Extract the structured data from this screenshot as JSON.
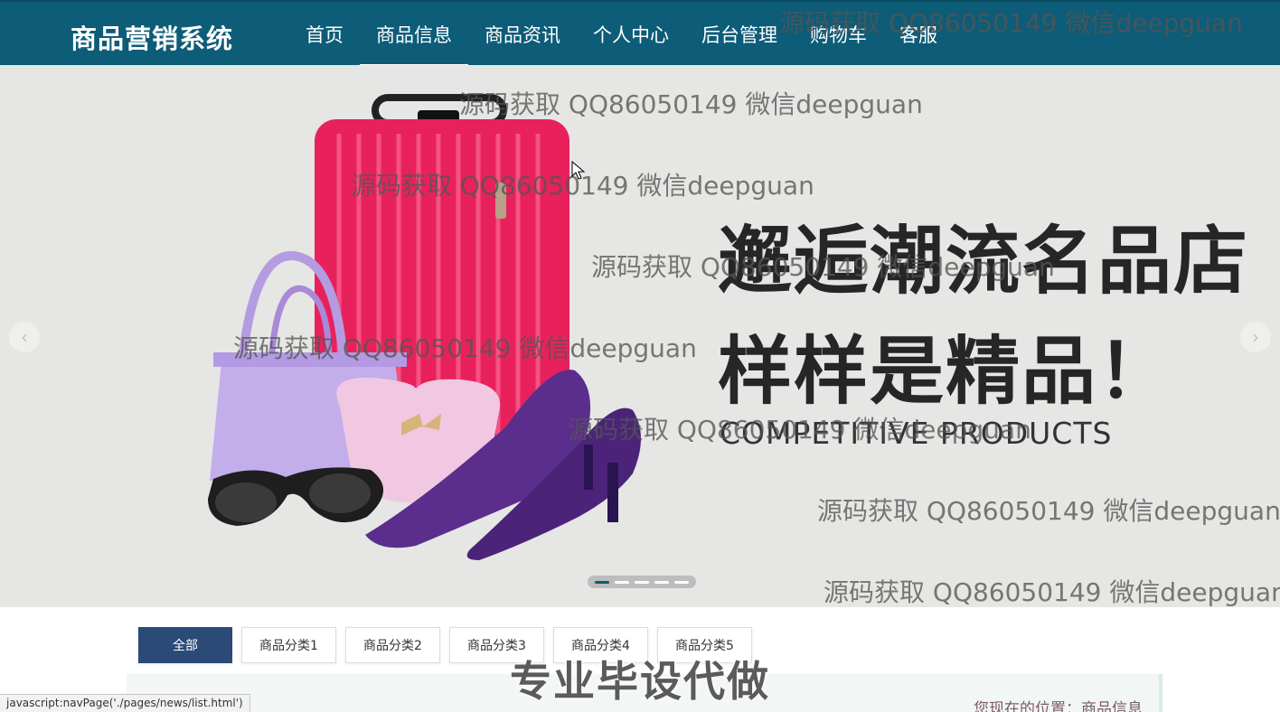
{
  "app": {
    "brand": "商品营销系统"
  },
  "nav": {
    "items": [
      {
        "label": "首页"
      },
      {
        "label": "商品信息"
      },
      {
        "label": "商品资讯"
      },
      {
        "label": "个人中心"
      },
      {
        "label": "后台管理"
      },
      {
        "label": "购物车"
      },
      {
        "label": "客服"
      }
    ],
    "active": "商品信息"
  },
  "banner": {
    "headline_1": "邂逅潮流名品店",
    "headline_2": "样样是精品！",
    "headline_3": "COMPETITIVE PRODUCTS",
    "slide_count": 5,
    "active_slide": 1
  },
  "categories": {
    "items": [
      {
        "label": "全部"
      },
      {
        "label": "商品分类1"
      },
      {
        "label": "商品分类2"
      },
      {
        "label": "商品分类3"
      },
      {
        "label": "商品分类4"
      },
      {
        "label": "商品分类5"
      }
    ],
    "active": "全部"
  },
  "breadcrumb": {
    "text": "您现在的位置：商品信息"
  },
  "overlay": {
    "label": "专业毕设代做"
  },
  "watermark": {
    "text": "源码获取 QQ86050149 微信deepguan"
  },
  "status_bar": {
    "url": "javascript:navPage('./pages/news/list.html')"
  },
  "colors": {
    "header_bg": "#0d5c78",
    "banner_bg": "#e6e6e4",
    "active_category": "#2b4a78"
  }
}
